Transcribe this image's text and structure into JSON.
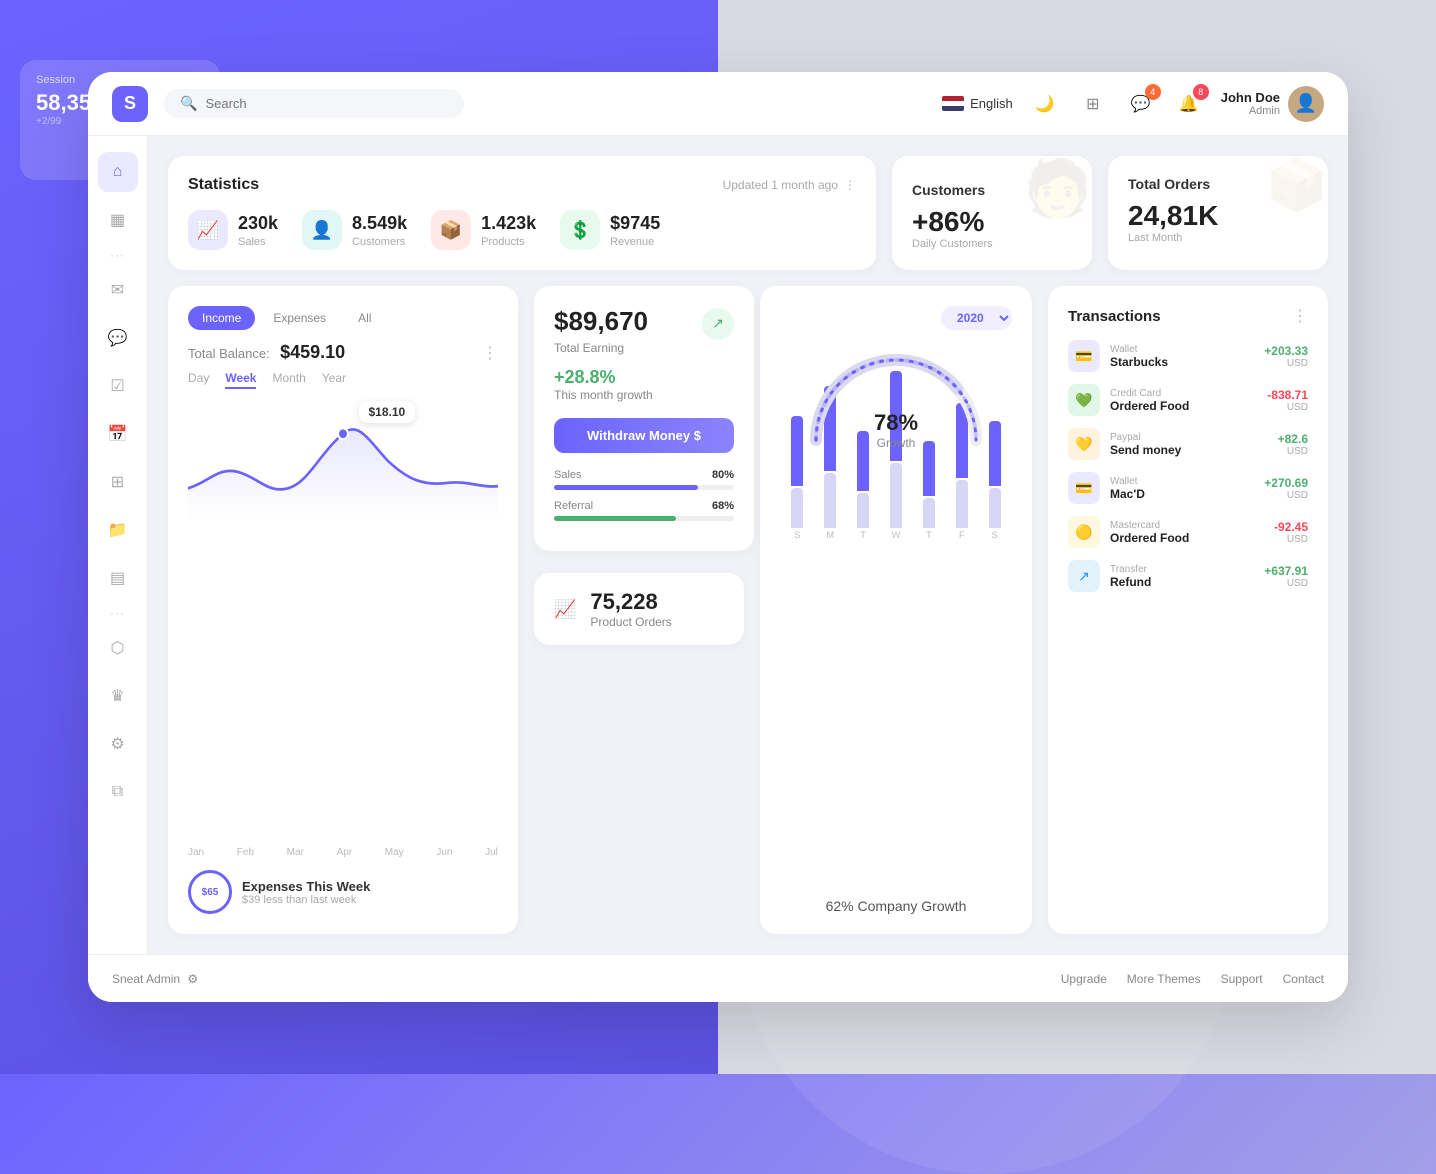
{
  "app": {
    "logo": "S",
    "name": "Sneat Admin"
  },
  "topbar": {
    "search_placeholder": "Search",
    "language": "English",
    "notifications_count": "8",
    "messages_count": "4",
    "user_name": "John Doe",
    "user_role": "Admin"
  },
  "sidebar": {
    "items": [
      {
        "id": "home",
        "icon": "⌂",
        "active": true
      },
      {
        "id": "layout",
        "icon": "▦"
      },
      {
        "id": "dots1",
        "icon": "···"
      },
      {
        "id": "mail",
        "icon": "✉"
      },
      {
        "id": "chat",
        "icon": "▣"
      },
      {
        "id": "check",
        "icon": "☑"
      },
      {
        "id": "calendar",
        "icon": "▭"
      },
      {
        "id": "grid",
        "icon": "⊞"
      },
      {
        "id": "folder",
        "icon": "▱"
      },
      {
        "id": "table",
        "icon": "▤"
      },
      {
        "id": "dots2",
        "icon": "···"
      },
      {
        "id": "box",
        "icon": "⬡"
      },
      {
        "id": "crown",
        "icon": "♛"
      },
      {
        "id": "settings",
        "icon": "⚙"
      },
      {
        "id": "copy",
        "icon": "⧉"
      }
    ]
  },
  "statistics": {
    "title": "Statistics",
    "updated": "Updated 1 month ago",
    "stats": [
      {
        "icon": "📈",
        "icon_type": "blue",
        "value": "230k",
        "label": "Sales"
      },
      {
        "icon": "👤",
        "icon_type": "teal",
        "value": "8.549k",
        "label": "Customers"
      },
      {
        "icon": "📦",
        "icon_type": "red",
        "value": "1.423k",
        "label": "Products"
      },
      {
        "icon": "💲",
        "icon_type": "green",
        "value": "$9745",
        "label": "Revenue"
      }
    ]
  },
  "customers": {
    "title": "Customers",
    "percentage": "+86%",
    "label": "Daily Customers"
  },
  "total_orders": {
    "title": "Total Orders",
    "value": "24,81K",
    "label": "Last Month"
  },
  "income": {
    "tabs": [
      "Income",
      "Expenses",
      "All"
    ],
    "active_tab": "Income",
    "balance_label": "Total Balance:",
    "balance_value": "$459.10",
    "periods": [
      "Day",
      "Week",
      "Month",
      "Year"
    ],
    "active_period": "Week",
    "tooltip_value": "$18.10",
    "months": [
      "Jan",
      "Feb",
      "Mar",
      "Apr",
      "May",
      "Jun",
      "Jul"
    ],
    "expenses_label": "Expenses This Week",
    "expenses_sub": "$39 less than last week",
    "expenses_circle": "$65"
  },
  "earning": {
    "value": "$89,670",
    "label": "Total Earning",
    "growth_pct": "+28.8%",
    "growth_label": "This month growth",
    "withdraw_label": "Withdraw Money  $",
    "sales_label": "Sales",
    "sales_pct": 80,
    "sales_pct_text": "80%",
    "referral_label": "Referral",
    "referral_pct": 68,
    "referral_pct_text": "68%"
  },
  "product_orders": {
    "value": "75,228",
    "label": "Product Orders"
  },
  "growth": {
    "year": "2020",
    "percentage": "78%",
    "sub": "Growth",
    "company_label": "62% Company Growth",
    "bars": [
      {
        "day": "S",
        "heights": [
          70,
          40
        ]
      },
      {
        "day": "M",
        "heights": [
          85,
          55
        ]
      },
      {
        "day": "T",
        "heights": [
          60,
          35
        ]
      },
      {
        "day": "W",
        "heights": [
          90,
          65
        ]
      },
      {
        "day": "T",
        "heights": [
          55,
          30
        ]
      },
      {
        "day": "F",
        "heights": [
          75,
          48
        ]
      },
      {
        "day": "S",
        "heights": [
          65,
          40
        ]
      }
    ]
  },
  "transactions": {
    "title": "Transactions",
    "items": [
      {
        "type": "wallet",
        "category": "Wallet",
        "name": "Starbucks",
        "amount": "+203.33",
        "currency": "USD",
        "positive": true
      },
      {
        "type": "credit",
        "category": "Credit Card",
        "name": "Ordered Food",
        "amount": "-838.71",
        "currency": "USD",
        "positive": false
      },
      {
        "type": "paypal",
        "category": "Paypal",
        "name": "Send money",
        "amount": "+82.6",
        "currency": "USD",
        "positive": true
      },
      {
        "type": "wallet",
        "category": "Wallet",
        "name": "Mac'D",
        "amount": "+270.69",
        "currency": "USD",
        "positive": true
      },
      {
        "type": "master",
        "category": "Mastercard",
        "name": "Ordered Food",
        "amount": "-92.45",
        "currency": "USD",
        "positive": false
      },
      {
        "type": "transfer",
        "category": "Transfer",
        "name": "Refund",
        "amount": "+637.91",
        "currency": "USD",
        "positive": true
      }
    ]
  },
  "footer": {
    "brand": "Sneat Admin",
    "links": [
      "Upgrade",
      "More Themes",
      "Support",
      "Contact"
    ]
  }
}
